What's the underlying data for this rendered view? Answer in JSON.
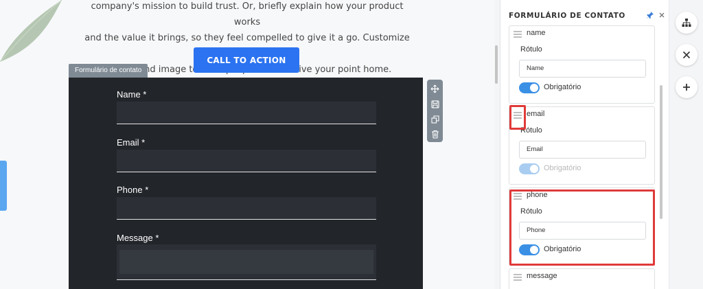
{
  "canvas": {
    "intro_lines": [
      "company's mission to build trust. Or, briefly explain how your product works",
      "and the value it brings, so they feel compelled to give it a go. Customize the",
      "background image to draw people in and drive your point home."
    ],
    "cta_label": "CALL TO ACTION",
    "form_tag": "Formulário de contato",
    "fields": [
      {
        "label": "Name *"
      },
      {
        "label": "Email *"
      },
      {
        "label": "Phone *"
      },
      {
        "label": "Message *"
      }
    ],
    "tools": [
      "move-icon",
      "save-icon",
      "duplicate-icon",
      "trash-icon"
    ]
  },
  "panel": {
    "title": "FORMULÁRIO DE CONTATO",
    "cards": [
      {
        "name": "name",
        "rotulo": "Rótulo",
        "value": "Name",
        "required_label": "Obrigatório",
        "required": true
      },
      {
        "name": "email",
        "rotulo": "Rótulo",
        "value": "Email",
        "required_label": "Obrigatório",
        "required": true,
        "disabled": true
      },
      {
        "name": "phone",
        "rotulo": "Rótulo",
        "value": "Phone",
        "required_label": "Obrigatório",
        "required": true
      },
      {
        "name": "message"
      }
    ]
  },
  "rail": {
    "buttons": [
      "sitemap-icon",
      "close-icon",
      "add-icon"
    ]
  },
  "colors": {
    "accent": "#2b73f0",
    "form_bg": "#22252a",
    "highlight": "#e03a3a",
    "toggle": "#3a90e5"
  }
}
